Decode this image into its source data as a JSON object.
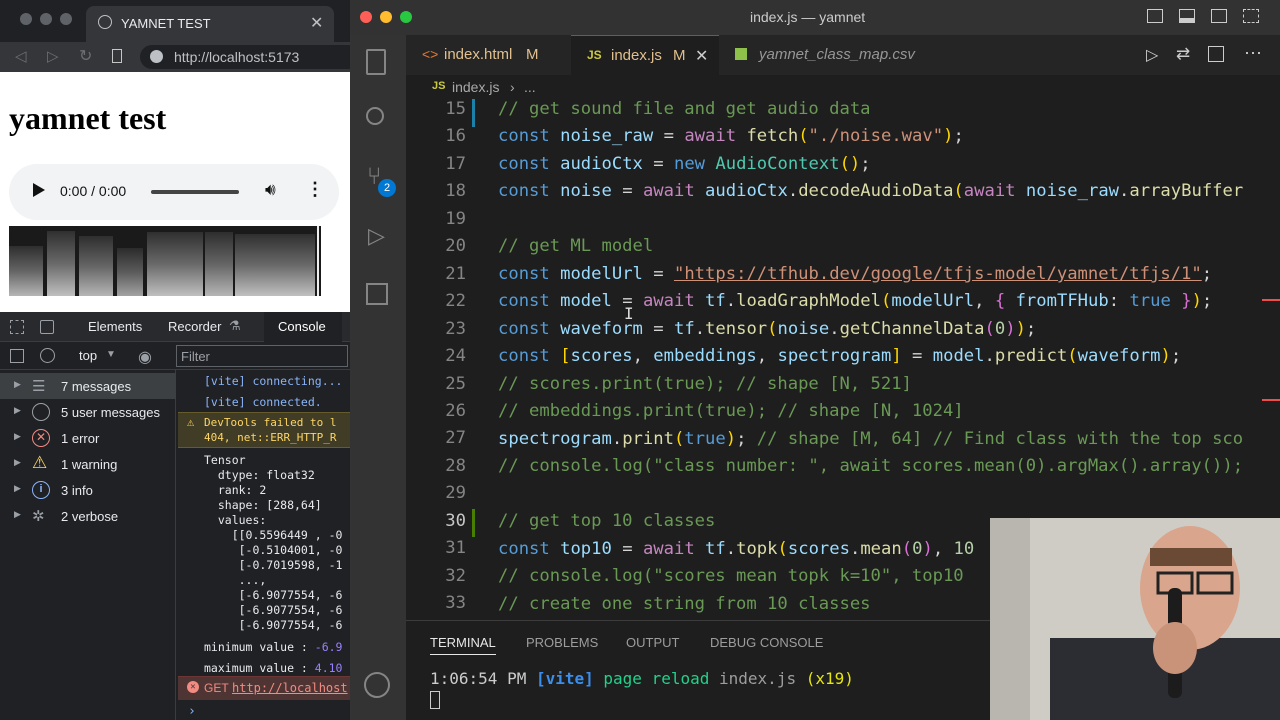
{
  "browser": {
    "tab_title": "YAMNET TEST",
    "url": "http://localhost:5173",
    "page_title": "yamnet test",
    "audio_time": "0:00 / 0:00"
  },
  "devtools": {
    "tabs": [
      "Elements",
      "Recorder",
      "Console"
    ],
    "context": "top",
    "filter_placeholder": "Filter",
    "sidebar": [
      {
        "label": "7 messages",
        "icon": "list-icon"
      },
      {
        "label": "5 user messages",
        "icon": "user-icon"
      },
      {
        "label": "1 error",
        "icon": "error-icon"
      },
      {
        "label": "1 warning",
        "icon": "warning-icon"
      },
      {
        "label": "3 info",
        "icon": "info-icon"
      },
      {
        "label": "2 verbose",
        "icon": "bug-icon"
      }
    ],
    "console": {
      "vite1": "[vite] connecting...",
      "vite2": "[vite] connected.",
      "warn1": "DevTools failed to l",
      "warn2": "404, net::ERR_HTTP_R",
      "tensor": "Tensor",
      "dtype": "  dtype: float32",
      "rank": "  rank: 2",
      "shape": "  shape: [288,64]",
      "values": "  values:",
      "v1": "    [[0.5596449 , -0",
      "v2": "     [-0.5104001, -0",
      "v3": "     [-0.7019598, -1",
      "v4": "     ...,",
      "v5": "     [-6.9077554, -6",
      "v6": "     [-6.9077554, -6",
      "v7": "     [-6.9077554, -6",
      "min_label": "minimum value : ",
      "min_val": "-6.9",
      "max_label": "maximum value : ",
      "max_val": "4.10",
      "get_method": "GET ",
      "get_url": "http://localhost"
    }
  },
  "vscode": {
    "window_title": "index.js — yamnet",
    "tabs": [
      {
        "label": "index.html",
        "badge": "M"
      },
      {
        "label": "index.js",
        "badge": "M"
      },
      {
        "label": "yamnet_class_map.csv",
        "badge": ""
      }
    ],
    "breadcrumb": "index.js",
    "breadcrumb_more": "...",
    "scm_badge": "2",
    "line_numbers": [
      "15",
      "16",
      "17",
      "18",
      "19",
      "20",
      "21",
      "22",
      "23",
      "24",
      "25",
      "26",
      "27",
      "28",
      "29",
      "30",
      "31",
      "32",
      "33"
    ],
    "panel_tabs": [
      "TERMINAL",
      "PROBLEMS",
      "OUTPUT",
      "DEBUG CONSOLE"
    ],
    "terminal": {
      "time": "1:06:54 PM",
      "tag": "[vite]",
      "msg": "page reload",
      "file": "index.js",
      "count": "(x19)"
    }
  },
  "code": {
    "l15": "// get sound file and get audio data",
    "l20": "// get ML model",
    "l21_url": "\"https://tfhub.dev/google/tfjs-model/yamnet/tfjs/1\"",
    "l16_str": "\"./noise.wav\"",
    "l25": "// scores.print(true); // shape [N, 521]",
    "l26": "// embeddings.print(true); // shape [N, 1024]",
    "l27_cmt": "// shape [M, 64] // Find class with the top sco",
    "l28": "// console.log(\"class number: \", await scores.mean(0).argMax().array());",
    "l30": "// get top 10 classes",
    "l32": "// console.log(\"scores mean topk k=10\", top10",
    "l33": "// create one string from 10 classes"
  }
}
